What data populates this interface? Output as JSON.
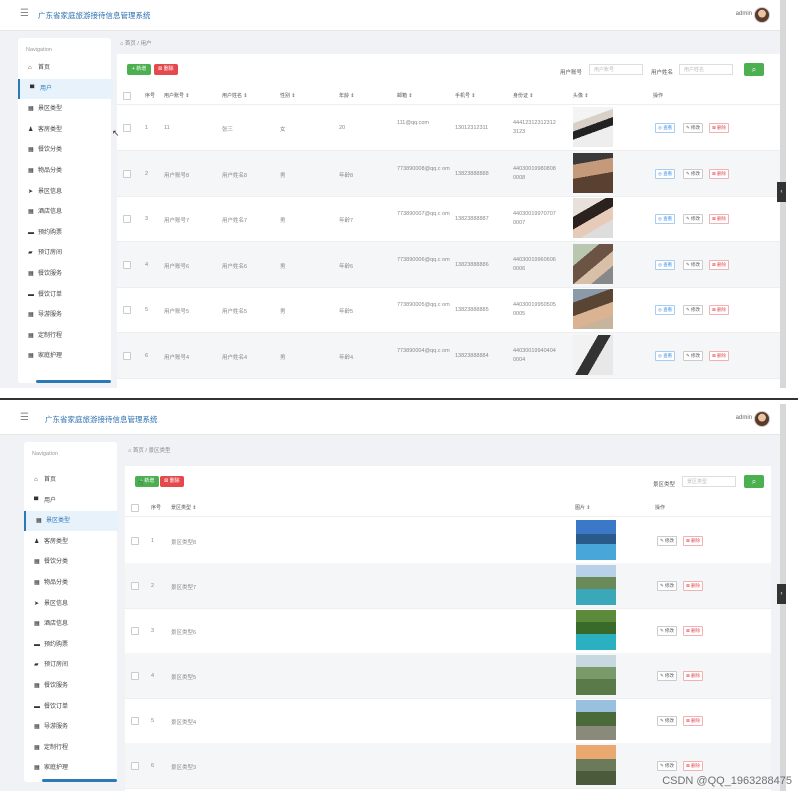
{
  "app_title": "广东省家庭旅游接待信息管理系统",
  "admin_name": "admin",
  "nav_title": "Navigation",
  "nav_items": [
    {
      "label": "首页",
      "icon": "home-icon"
    },
    {
      "label": "用户",
      "icon": "user-icon"
    },
    {
      "label": "景区类型",
      "icon": "grid-icon"
    },
    {
      "label": "客房类型",
      "icon": "person-icon"
    },
    {
      "label": "餐饮分类",
      "icon": "grid-icon"
    },
    {
      "label": "物品分类",
      "icon": "grid-icon"
    },
    {
      "label": "景区信息",
      "icon": "send-icon"
    },
    {
      "label": "酒店信息",
      "icon": "grid-icon"
    },
    {
      "label": "预约购票",
      "icon": "monitor-icon"
    },
    {
      "label": "预订房间",
      "icon": "comment-icon"
    },
    {
      "label": "餐饮服务",
      "icon": "grid-icon"
    },
    {
      "label": "餐饮订单",
      "icon": "monitor-icon"
    },
    {
      "label": "导游服务",
      "icon": "grid-icon"
    },
    {
      "label": "定制行程",
      "icon": "grid-icon"
    },
    {
      "label": "家庭护理",
      "icon": "grid-icon"
    }
  ],
  "screen1": {
    "breadcrumb": [
      "首页",
      "用户"
    ],
    "add_label": "+ 新增",
    "delete_label": "删除",
    "search": [
      {
        "label": "用户账号",
        "placeholder": "用户账号"
      },
      {
        "label": "用户姓名",
        "placeholder": "用户姓名"
      }
    ],
    "columns": [
      "序号",
      "用户账号 ⇕",
      "用户姓名 ⇕",
      "性别 ⇕",
      "年龄 ⇕",
      "邮箱 ⇕",
      "手机号 ⇕",
      "身份证 ⇕",
      "头像 ⇕",
      "操作"
    ],
    "rows": [
      {
        "no": "1",
        "account": "11",
        "name": "张三",
        "gender": "女",
        "age": "20",
        "email": "111@qq.com",
        "phone": "13012312311",
        "idcard": "44412312312312 3123"
      },
      {
        "no": "2",
        "account": "用户账号8",
        "name": "用户姓名8",
        "gender": "男",
        "age": "年龄8",
        "email": "773890008@qq.c om",
        "phone": "13823888888",
        "idcard": "44030019980808 0008"
      },
      {
        "no": "3",
        "account": "用户账号7",
        "name": "用户姓名7",
        "gender": "男",
        "age": "年龄7",
        "email": "773890007@qq.c om",
        "phone": "13823888887",
        "idcard": "44030019970707 0007"
      },
      {
        "no": "4",
        "account": "用户账号6",
        "name": "用户姓名6",
        "gender": "男",
        "age": "年龄6",
        "email": "773890006@qq.c om",
        "phone": "13823888886",
        "idcard": "44030019960606 0006"
      },
      {
        "no": "5",
        "account": "用户账号5",
        "name": "用户姓名5",
        "gender": "男",
        "age": "年龄5",
        "email": "773890005@qq.c om",
        "phone": "13823888885",
        "idcard": "44030019950505 0005"
      },
      {
        "no": "6",
        "account": "用户账号4",
        "name": "用户姓名4",
        "gender": "男",
        "age": "年龄4",
        "email": "773890004@qq.c om",
        "phone": "13823888884",
        "idcard": "44030019940404 0004"
      }
    ],
    "actions": {
      "view": "查看",
      "edit": "修改",
      "delete": "删除"
    }
  },
  "screen2": {
    "breadcrumb": [
      "首页",
      "景区类型"
    ],
    "add_label": "+ 新增",
    "delete_label": "删除",
    "search": [
      {
        "label": "景区类型",
        "placeholder": "景区类型"
      }
    ],
    "columns": [
      "序号",
      "景区类型 ⇕",
      "图片 ⇕",
      "操作"
    ],
    "rows": [
      {
        "no": "1",
        "type": "景区类型8"
      },
      {
        "no": "2",
        "type": "景区类型7"
      },
      {
        "no": "3",
        "type": "景区类型6"
      },
      {
        "no": "4",
        "type": "景区类型5"
      },
      {
        "no": "5",
        "type": "景区类型4"
      },
      {
        "no": "6",
        "type": "景区类型3"
      }
    ],
    "actions": {
      "edit": "修改",
      "delete": "删除"
    }
  },
  "watermark": "CSDN @QQ_1963288475",
  "colors": {
    "accent": "#2a7ab8",
    "add": "#4caf50",
    "delete": "#e5484d"
  }
}
